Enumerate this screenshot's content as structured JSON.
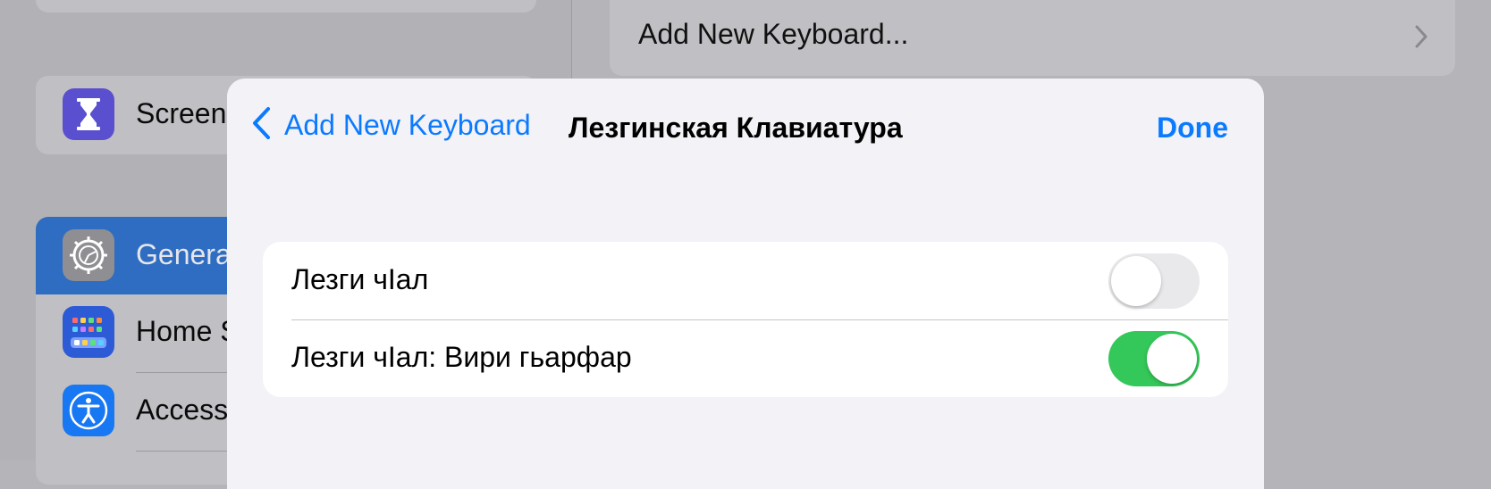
{
  "sidebar": {
    "items": [
      {
        "label": "Screen Time",
        "icon": "hourglass-icon",
        "color": "#5a4fcf"
      },
      {
        "label": "General",
        "icon": "gear-icon",
        "color": "#8e8e93",
        "selected": true
      },
      {
        "label": "Home Screen & Dock",
        "icon": "home-screen-grid-icon",
        "color": "#2d5bd6"
      },
      {
        "label": "Accessibility",
        "icon": "accessibility-icon",
        "color": "#1877f2"
      }
    ]
  },
  "right_pane": {
    "add_keyboard_label": "Add New Keyboard..."
  },
  "modal": {
    "back_label": "Add New Keyboard",
    "title": "Лезгинская Клавиатура",
    "done_label": "Done",
    "options": [
      {
        "label": "Лезги чIал",
        "enabled": false
      },
      {
        "label": "Лезги чIал: Вири гьарфар",
        "enabled": true
      }
    ]
  },
  "colors": {
    "accent": "#0a7aff",
    "toggle_on": "#34c759",
    "toggle_off": "#e9e9eb",
    "sidebar_selected": "#2e6dc1"
  }
}
